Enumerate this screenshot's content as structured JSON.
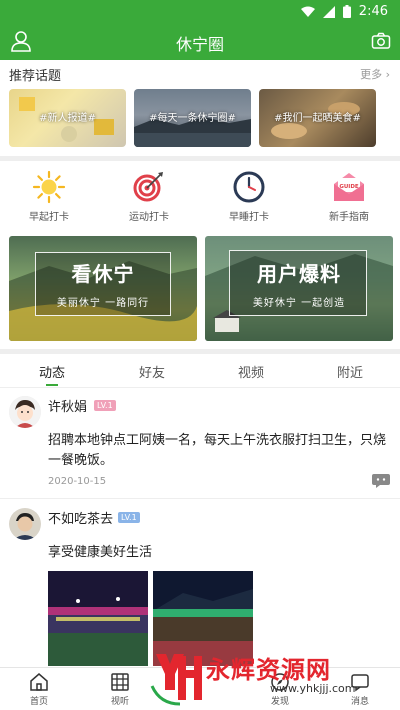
{
  "status_bar": {
    "time": "2:46"
  },
  "app_bar": {
    "title": "休宁圈"
  },
  "topics": {
    "title": "推荐话题",
    "more": "更多",
    "items": [
      {
        "label": "#新人报道#"
      },
      {
        "label": "#每天一条休宁圈#"
      },
      {
        "label": "#我们一起晒美食#"
      }
    ]
  },
  "checkins": [
    {
      "label": "早起打卡",
      "icon": "sun-icon"
    },
    {
      "label": "运动打卡",
      "icon": "target-icon"
    },
    {
      "label": "早睡打卡",
      "icon": "clock-icon"
    },
    {
      "label": "新手指南",
      "icon": "guide-envelope-icon",
      "icon_text": "GUIDE"
    }
  ],
  "banners": [
    {
      "title": "看休宁",
      "subtitle": "美丽休宁  一路同行"
    },
    {
      "title": "用户爆料",
      "subtitle": "美好休宁  一起创造"
    }
  ],
  "tabs": [
    {
      "label": "动态",
      "active": true
    },
    {
      "label": "好友"
    },
    {
      "label": "视频"
    },
    {
      "label": "附近"
    }
  ],
  "posts": [
    {
      "name": "许秋娟",
      "level": "LV.1",
      "text": "招聘本地钟点工阿姨一名，每天上午洗衣服打扫卫生，只烧一餐晚饭。",
      "date": "2020-10-15"
    },
    {
      "name": "不如吃茶去",
      "level": "LV.1",
      "text": "享受健康美好生活"
    }
  ],
  "bottom_nav": [
    {
      "label": "首页",
      "icon": "home-icon"
    },
    {
      "label": "视听",
      "icon": "film-icon"
    },
    {
      "label": "发现",
      "icon": "discover-icon"
    },
    {
      "label": "消息",
      "icon": "message-icon"
    }
  ],
  "watermark": {
    "text": "永辉资源网",
    "url": "www.yhkjjj.com",
    "logo_text": "YH"
  },
  "colors": {
    "brand_green": "#3aaa3a",
    "badge_pink": "#f0a0b8",
    "badge_blue": "#8ab4e8",
    "watermark_red": "#e3262e"
  }
}
